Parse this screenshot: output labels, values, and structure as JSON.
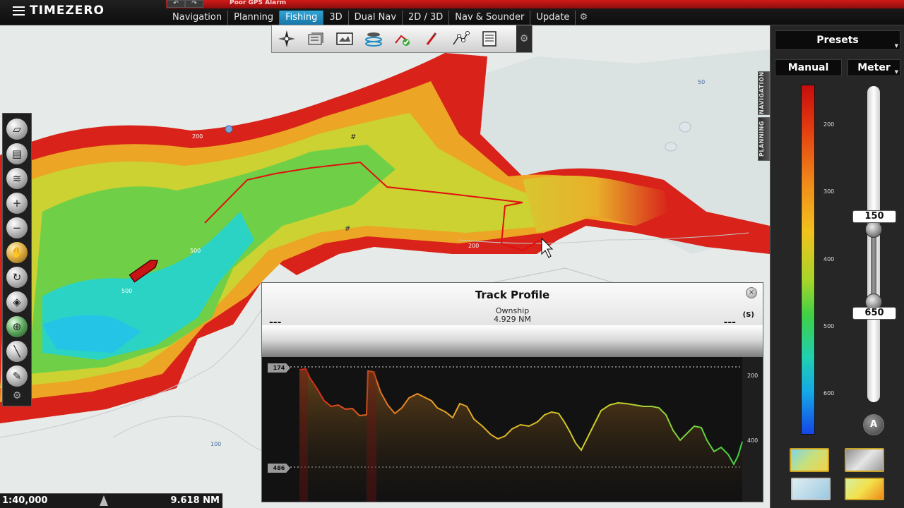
{
  "app": {
    "title": "TIMEZERO",
    "alarm": "Poor GPS Alarm"
  },
  "tabs": [
    {
      "label": "Navigation",
      "active": false
    },
    {
      "label": "Planning",
      "active": false
    },
    {
      "label": "Fishing",
      "active": true
    },
    {
      "label": "3D",
      "active": false
    },
    {
      "label": "Dual Nav",
      "active": false
    },
    {
      "label": "2D / 3D",
      "active": false
    },
    {
      "label": "Nav & Sounder",
      "active": false
    },
    {
      "label": "Update",
      "active": false
    }
  ],
  "ribbon_icons": [
    "compass-icon",
    "chart-catalog-icon",
    "screenshot-icon",
    "depth-shading-icon",
    "route-tool-icon",
    "event-marker-icon",
    "waypoint-network-icon",
    "report-icon",
    "settings-icon"
  ],
  "left_tools": [
    "ruler-icon",
    "chart-tool-icon",
    "layers-icon",
    "zoom-in-icon",
    "zoom-out-icon",
    "pan-hand-icon",
    "rotate-icon",
    "center-icon",
    "waypoint-icon",
    "mob-icon",
    "pen-icon"
  ],
  "side_tabs": [
    "NAVIGATION",
    "PLANNING"
  ],
  "map_labels": {
    "d50": "50",
    "d200a": "200",
    "d200b": "200",
    "d500a": "500",
    "d500b": "500",
    "d100": "100"
  },
  "status": {
    "scale": "1:40,000",
    "distance": "9.618 NM"
  },
  "palette": {
    "presets": "Presets",
    "mode": "Manual",
    "unit": "Meter",
    "scale_labels": [
      "200",
      "300",
      "400",
      "500",
      "600"
    ],
    "min_value": "150",
    "max_value": "650",
    "auto": "A"
  },
  "track_profile": {
    "title": "Track Profile",
    "source": "Ownship",
    "distance": "4.929 NM",
    "left_value": "---",
    "right_value": "---",
    "unit": "(S)",
    "top_tag": "174",
    "bottom_tag": "486",
    "axis_labels": [
      "200",
      "400"
    ],
    "close": "×"
  },
  "colors": {
    "accent": "#1f8fc4",
    "alarm": "#c81414",
    "track": "#e01010"
  }
}
